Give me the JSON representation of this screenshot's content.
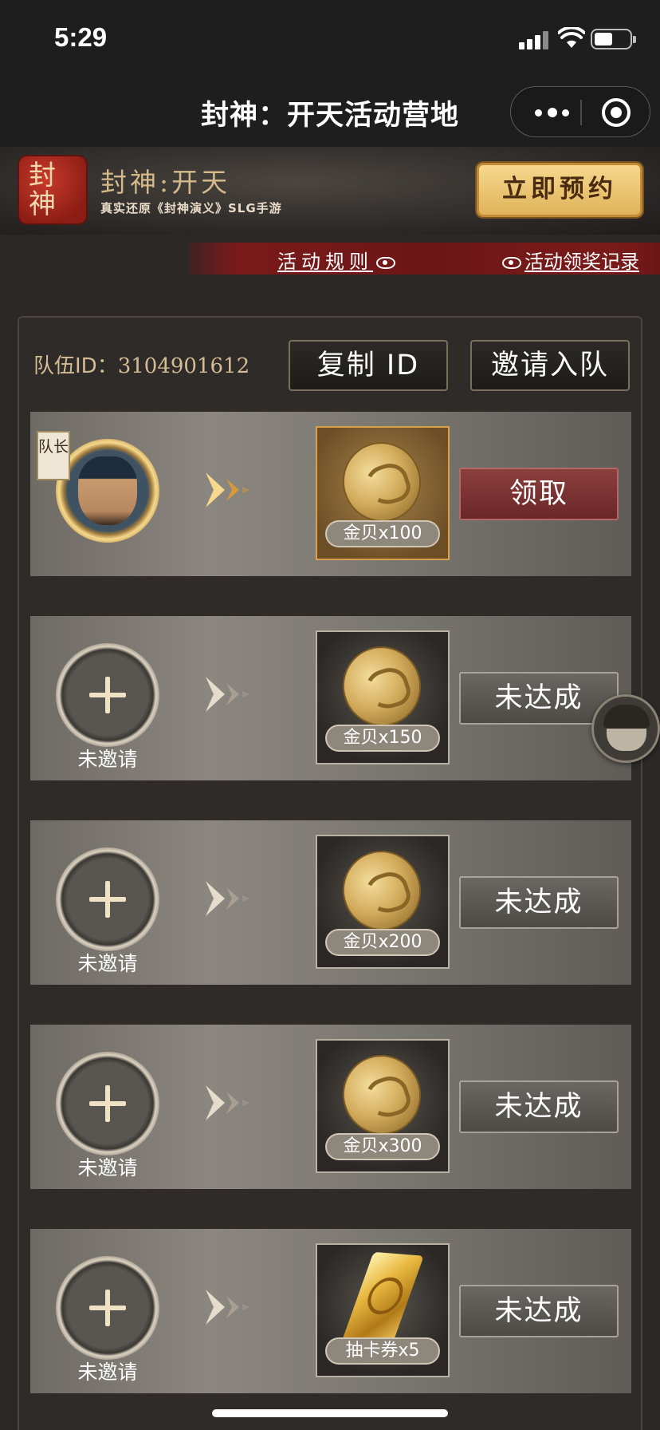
{
  "status_bar": {
    "time": "5:29"
  },
  "nav": {
    "title": "封神：开天活动营地"
  },
  "banner": {
    "logo_text": "封神",
    "game_name": "封神:开天",
    "subtitle": "真实还原《封神演义》SLG手游",
    "reserve_label": "立即预约"
  },
  "links": {
    "rules": "活动规则",
    "record": "活动领奖记录"
  },
  "team": {
    "id_label": "队伍ID：",
    "id_value": "3104901612",
    "copy_label": "复制 ID",
    "invite_label": "邀请入队"
  },
  "rows": [
    {
      "slot": "captain",
      "badge": "队长",
      "slot_label": "",
      "reward": "金贝x100",
      "reward_icon": "gold-shell-icon",
      "action": "领取",
      "state": "claimable"
    },
    {
      "slot": "empty",
      "badge": "",
      "slot_label": "未邀请",
      "reward": "金贝x150",
      "reward_icon": "gold-shell-icon",
      "action": "未达成",
      "state": "locked"
    },
    {
      "slot": "empty",
      "badge": "",
      "slot_label": "未邀请",
      "reward": "金贝x200",
      "reward_icon": "gold-shell-icon",
      "action": "未达成",
      "state": "locked"
    },
    {
      "slot": "empty",
      "badge": "",
      "slot_label": "未邀请",
      "reward": "金贝x300",
      "reward_icon": "gold-shell-icon",
      "action": "未达成",
      "state": "locked"
    },
    {
      "slot": "empty",
      "badge": "",
      "slot_label": "未邀请",
      "reward": "抽卡券x5",
      "reward_icon": "card-ticket-icon",
      "action": "未达成",
      "state": "locked"
    }
  ],
  "colors": {
    "accent_gold": "#e0b35a",
    "claim_red": "#7a2e2d",
    "panel_bg": "#2e2b29"
  }
}
